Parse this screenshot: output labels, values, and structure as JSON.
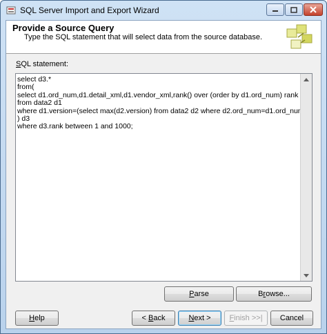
{
  "window": {
    "title": "SQL Server Import and Export Wizard"
  },
  "header": {
    "title": "Provide a Source Query",
    "subtitle": "Type the SQL statement that will select data from the source database."
  },
  "sql": {
    "label_prefix": "",
    "label_hotkey": "S",
    "label_rest": "QL statement:",
    "value": "select d3.*\nfrom(\nselect d1.ord_num,d1.detail_xml,d1.vendor_xml,rank() over (order by d1.ord_num) rank\nfrom data2 d1\nwhere d1.version=(select max(d2.version) from data2 d2 where d2.ord_num=d1.ord_num)\n) d3\nwhere d3.rank between 1 and 1000;"
  },
  "buttons": {
    "parse": {
      "hotkey": "P",
      "rest": "arse"
    },
    "browse": {
      "hotkey": "",
      "rest": "Browse...",
      "pre": "B",
      "mid": "r",
      "post": "owse..."
    },
    "help": {
      "hotkey": "H",
      "rest": "elp"
    },
    "back": {
      "pre": "< ",
      "hotkey": "B",
      "rest": "ack"
    },
    "next": {
      "hotkey": "N",
      "rest": "ext >"
    },
    "finish": {
      "hotkey": "F",
      "rest": "inish >>|"
    },
    "cancel": {
      "label": "Cancel"
    }
  }
}
